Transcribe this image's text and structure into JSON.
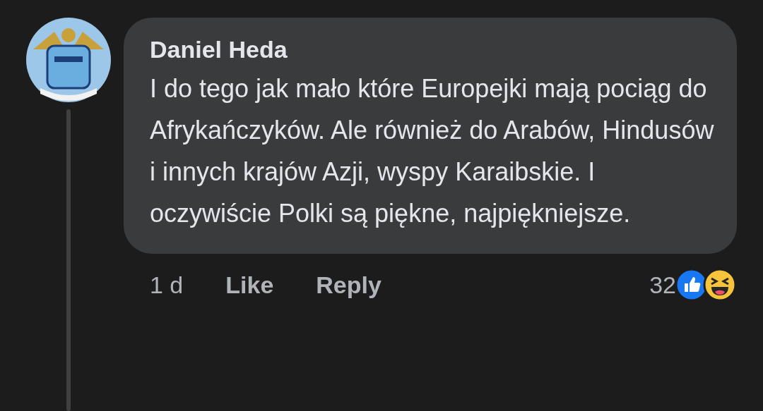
{
  "comment": {
    "author": "Daniel Heda",
    "text": "I do tego jak mało które Europejki mają pociąg do Afrykańczyków. Ale również do Arabów, Hindusów i innych krajów Azji, wyspy Karaibskie. I oczywiście Polki są piękne, najpiękniejsze.",
    "time": "1 d",
    "actions": [
      "Like",
      "Reply"
    ],
    "reaction_count": "32",
    "reactions": [
      {
        "kind": "like"
      },
      {
        "kind": "haha"
      }
    ]
  }
}
